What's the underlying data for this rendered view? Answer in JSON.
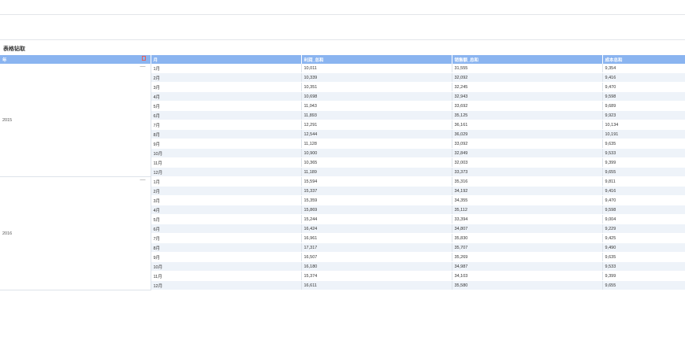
{
  "panel": {
    "title": "表格钻取"
  },
  "table": {
    "headers": [
      "年",
      "月",
      "利润_总和",
      "销售额_总和",
      "成本总和"
    ],
    "groups": [
      {
        "year": "2015",
        "rows": [
          [
            "1月",
            "10,011",
            "31,555",
            "9,354"
          ],
          [
            "2月",
            "10,339",
            "32,092",
            "9,416"
          ],
          [
            "3月",
            "10,351",
            "32,245",
            "9,470"
          ],
          [
            "4月",
            "10,698",
            "32,943",
            "9,598"
          ],
          [
            "5月",
            "11,043",
            "33,692",
            "9,689"
          ],
          [
            "6月",
            "11,893",
            "35,125",
            "9,923"
          ],
          [
            "7月",
            "12,291",
            "36,161",
            "10,134"
          ],
          [
            "8月",
            "12,544",
            "36,029",
            "10,191"
          ],
          [
            "9月",
            "11,128",
            "33,092",
            "9,635"
          ],
          [
            "10月",
            "10,900",
            "32,849",
            "9,533"
          ],
          [
            "11月",
            "10,365",
            "32,003",
            "9,399"
          ],
          [
            "12月",
            "11,189",
            "33,373",
            "9,655"
          ]
        ]
      },
      {
        "year": "2016",
        "rows": [
          [
            "1月",
            "15,594",
            "35,316",
            "9,811"
          ],
          [
            "2月",
            "15,337",
            "34,192",
            "9,416"
          ],
          [
            "3月",
            "15,359",
            "34,355",
            "9,470"
          ],
          [
            "4月",
            "15,869",
            "35,112",
            "9,598"
          ],
          [
            "5月",
            "15,244",
            "33,394",
            "9,004"
          ],
          [
            "6月",
            "16,424",
            "34,807",
            "9,229"
          ],
          [
            "7月",
            "16,961",
            "35,830",
            "9,425"
          ],
          [
            "8月",
            "17,317",
            "35,707",
            "9,490"
          ],
          [
            "9月",
            "16,507",
            "35,269",
            "9,635"
          ],
          [
            "10月",
            "16,180",
            "34,987",
            "9,533"
          ],
          [
            "11月",
            "15,374",
            "34,103",
            "9,399"
          ],
          [
            "12月",
            "16,611",
            "35,580",
            "9,655"
          ]
        ]
      }
    ]
  }
}
